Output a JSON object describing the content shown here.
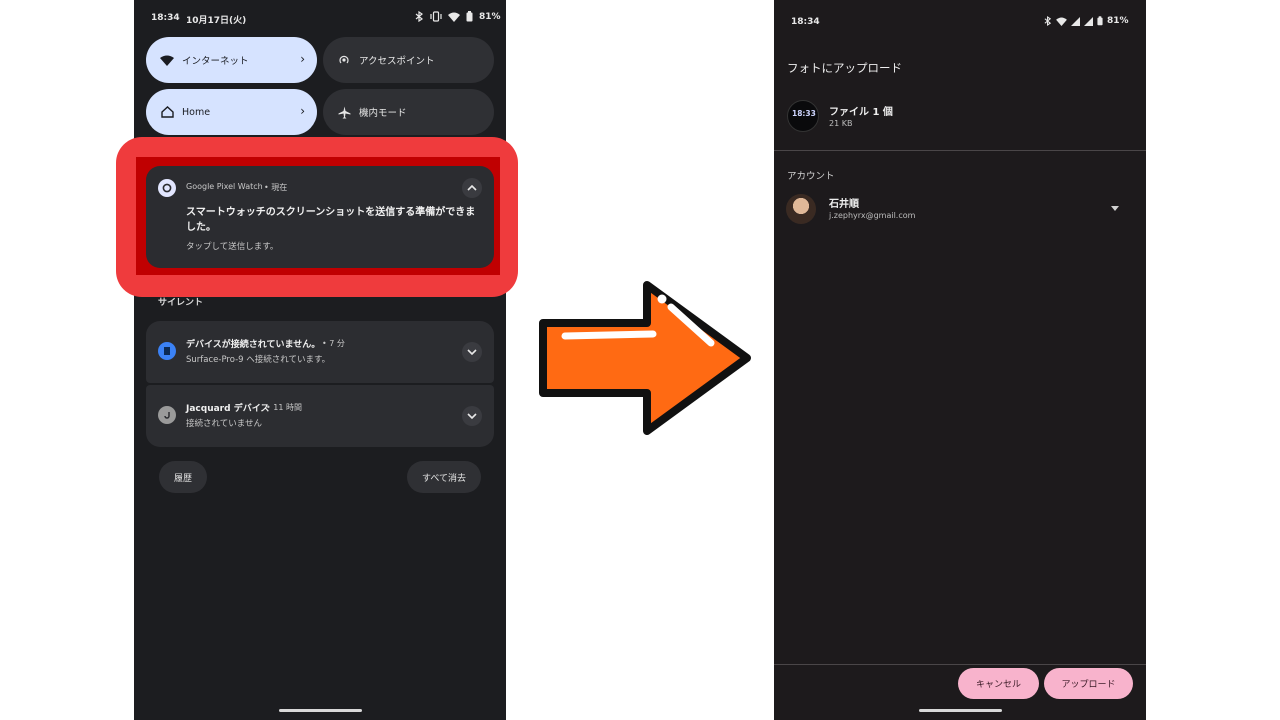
{
  "left_phone": {
    "status": {
      "time": "18:34",
      "date": "10月17日(火)",
      "battery": "81%"
    },
    "tiles": [
      {
        "label": "インターネット",
        "icon": "wifi-icon",
        "active": true
      },
      {
        "label": "アクセスポイント",
        "icon": "hotspot-icon",
        "active": false
      },
      {
        "label": "Home",
        "icon": "home-icon",
        "active": true
      },
      {
        "label": "機内モード",
        "icon": "airplane-icon",
        "active": false
      }
    ],
    "pixel_notification": {
      "app": "Google Pixel Watch",
      "when": "• 現在",
      "title": "スマートウォッチのスクリーンショットを送信する準備ができました。",
      "subtitle": "タップして送信します。"
    },
    "silent_label": "サイレント",
    "notifications": [
      {
        "title": "デバイスが接続されていません。",
        "time": "• 7 分",
        "body": "Surface-Pro-9 へ接続されています。",
        "icon_color": "#3b82f6"
      },
      {
        "title": "Jacquard デバイス",
        "time": "• 11 時間",
        "body": "接続されていません",
        "icon_color": "#9a9a9a"
      }
    ],
    "history_button": "履歴",
    "clear_all_button": "すべて消去"
  },
  "right_phone": {
    "status": {
      "time": "18:34",
      "battery": "81%"
    },
    "title": "フォトにアップロード",
    "file": {
      "thumb_time": "18:33",
      "name": "ファイル 1 個",
      "size": "21 KB"
    },
    "account_label": "アカウント",
    "account": {
      "name": "石井順",
      "email": "j.zephyrx@gmail.com"
    },
    "cancel_button": "キャンセル",
    "upload_button": "アップロード"
  },
  "colors": {
    "highlight_red": "#ef3b3d",
    "arrow_orange": "#ff6a13",
    "pink_button": "#f8b3cc",
    "tile_active": "#d6e3ff"
  }
}
